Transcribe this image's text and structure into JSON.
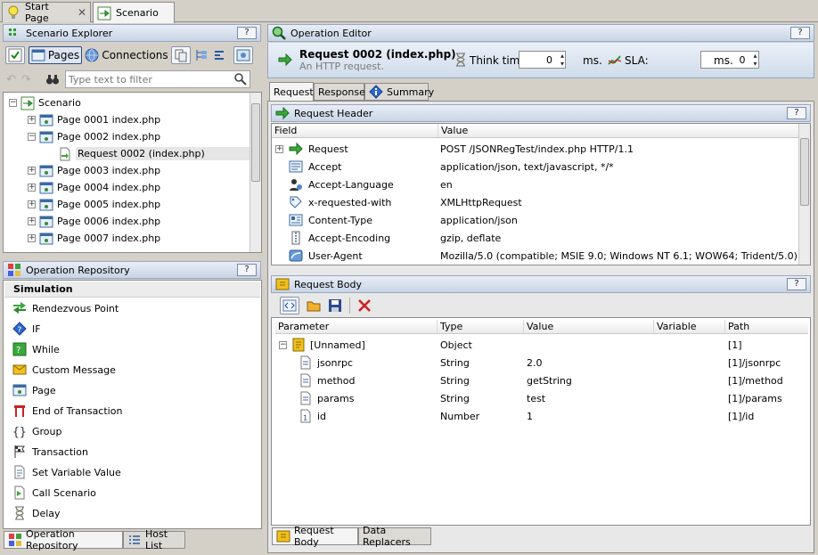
{
  "tabs": {
    "start_page": "Start Page",
    "scenario": "Scenario"
  },
  "explorer": {
    "title": "Scenario Explorer",
    "help": "?",
    "pages_btn": "Pages",
    "connections_btn": "Connections",
    "filter_placeholder": "Type text to filter",
    "tree": [
      {
        "label": "Scenario",
        "level": 0,
        "exp": "−",
        "icon": "scenario"
      },
      {
        "label": "Page 0001 index.php",
        "level": 1,
        "exp": "+",
        "icon": "page"
      },
      {
        "label": "Page 0002 index.php",
        "level": 1,
        "exp": "−",
        "icon": "page"
      },
      {
        "label": "Request 0002 (index.php)",
        "level": 2,
        "exp": "",
        "icon": "request",
        "selected": true
      },
      {
        "label": "Page 0003 index.php",
        "level": 1,
        "exp": "+",
        "icon": "page"
      },
      {
        "label": "Page 0004 index.php",
        "level": 1,
        "exp": "+",
        "icon": "page"
      },
      {
        "label": "Page 0005 index.php",
        "level": 1,
        "exp": "+",
        "icon": "page"
      },
      {
        "label": "Page 0006 index.php",
        "level": 1,
        "exp": "+",
        "icon": "page"
      },
      {
        "label": "Page 0007 index.php",
        "level": 1,
        "exp": "+",
        "icon": "page"
      }
    ]
  },
  "repository": {
    "title": "Operation Repository",
    "help": "?",
    "section": "Simulation",
    "items": [
      {
        "label": "Rendezvous Point",
        "icon": "rendezvous-icon"
      },
      {
        "label": "IF",
        "icon": "if-icon"
      },
      {
        "label": "While",
        "icon": "while-icon"
      },
      {
        "label": "Custom Message",
        "icon": "custom-message-icon"
      },
      {
        "label": "Page",
        "icon": "page-icon"
      },
      {
        "label": "End of Transaction",
        "icon": "end-transaction-icon"
      },
      {
        "label": "Group",
        "icon": "group-icon"
      },
      {
        "label": "Transaction",
        "icon": "transaction-icon"
      },
      {
        "label": "Set Variable Value",
        "icon": "set-variable-icon"
      },
      {
        "label": "Call Scenario",
        "icon": "call-scenario-icon"
      },
      {
        "label": "Delay",
        "icon": "delay-icon"
      }
    ],
    "bottom_tabs": [
      "Operation Repository",
      "Host List"
    ]
  },
  "editor": {
    "title": "Operation Editor",
    "help": "?",
    "request_title": "Request 0002 (index.php)",
    "request_sub": "An HTTP request.",
    "think_time_label": "Think time:",
    "think_time_value": "0",
    "think_unit": "ms.",
    "sla_label": "SLA:",
    "sla_value": "0",
    "sla_unit": "ms.",
    "tabs": [
      "Request",
      "Response",
      "Summary"
    ]
  },
  "header_panel": {
    "title": "Request Header",
    "help": "?",
    "col_field": "Field",
    "col_value": "Value",
    "rows": [
      {
        "field": "Request",
        "value": "POST /JSONRegTest/index.php HTTP/1.1",
        "icon": "request-line-icon",
        "exp": true
      },
      {
        "field": "Accept",
        "value": "application/json, text/javascript, */*",
        "icon": "accept-icon"
      },
      {
        "field": "Accept-Language",
        "value": "en",
        "icon": "language-icon"
      },
      {
        "field": "x-requested-with",
        "value": "XMLHttpRequest",
        "icon": "header-tag-icon"
      },
      {
        "field": "Content-Type",
        "value": "application/json",
        "icon": "content-type-icon"
      },
      {
        "field": "Accept-Encoding",
        "value": "gzip, deflate",
        "icon": "encoding-icon"
      },
      {
        "field": "User-Agent",
        "value": "Mozilla/5.0 (compatible; MSIE 9.0; Windows NT 6.1; WOW64; Trident/5.0)",
        "icon": "user-agent-icon"
      }
    ]
  },
  "body_panel": {
    "title": "Request Body",
    "help": "?",
    "columns": [
      "Parameter",
      "Type",
      "Value",
      "Variable",
      "Path"
    ],
    "rows": [
      {
        "param": "[Unnamed]",
        "type": "Object",
        "value": "",
        "variable": "",
        "path": "[1]",
        "level": 0
      },
      {
        "param": "jsonrpc",
        "type": "String",
        "value": "2.0",
        "variable": "",
        "path": "[1]/jsonrpc",
        "level": 1
      },
      {
        "param": "method",
        "type": "String",
        "value": "getString",
        "variable": "",
        "path": "[1]/method",
        "level": 1
      },
      {
        "param": "params",
        "type": "String",
        "value": "test",
        "variable": "",
        "path": "[1]/params",
        "level": 1
      },
      {
        "param": "id",
        "type": "Number",
        "value": "1",
        "variable": "",
        "path": "[1]/id",
        "level": 1
      }
    ],
    "bottom_tabs": [
      "Request Body",
      "Data Replacers"
    ]
  }
}
